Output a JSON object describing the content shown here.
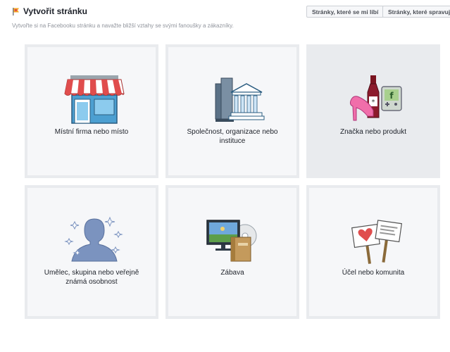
{
  "header": {
    "title": "Vytvořit stránku",
    "subtitle": "Vytvořte si na Facebooku stránku a navažte bližší vztahy se svými fanoušky a zákazníky.",
    "buttons": {
      "liked_pages": "Stránky, které se mi líbí",
      "managed_pages": "Stránky, které spravuji"
    }
  },
  "categories": [
    {
      "label": "Místní firma nebo místo",
      "icon": "storefront-icon"
    },
    {
      "label": "Společnost, organizace nebo instituce",
      "icon": "company-building-icon"
    },
    {
      "label": "Značka nebo produkt",
      "icon": "brand-product-icon"
    },
    {
      "label": "Umělec, skupina nebo veřejně známá osobnost",
      "icon": "artist-silhouette-icon"
    },
    {
      "label": "Zábava",
      "icon": "entertainment-icon"
    },
    {
      "label": "Účel nebo komunita",
      "icon": "cause-signs-icon"
    }
  ],
  "colors": {
    "tile_bg": "#f6f7f9",
    "tile_border": "#e9ebee",
    "active_tile_bg": "#e9ebee",
    "awning_red": "#e04d4d",
    "facebook_blue": "#4267b2"
  }
}
